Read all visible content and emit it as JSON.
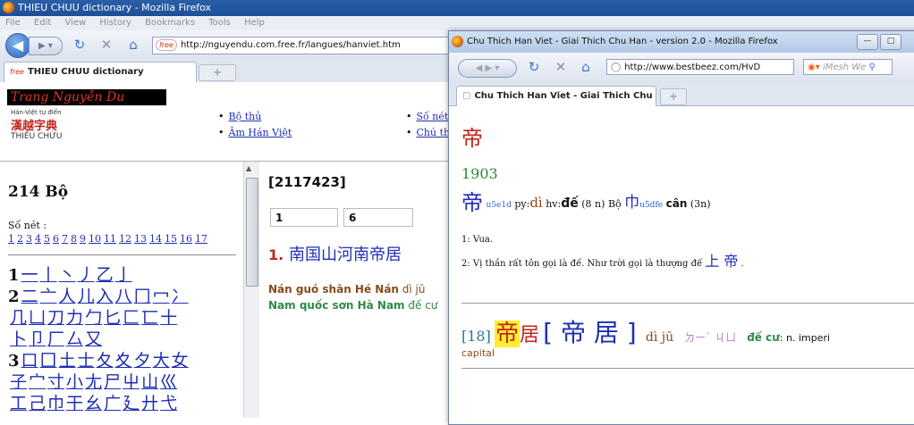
{
  "main_window": {
    "title": "THIEU CHUU dictionary - Mozilla Firefox",
    "menu": [
      "File",
      "Edit",
      "View",
      "History",
      "Bookmarks",
      "Tools",
      "Help"
    ],
    "url": "http://nguyendu.com.free.fr/langues/hanviet.htm",
    "url_favicon": "free",
    "tab_title": "THIEU CHUU dictionary",
    "logo": {
      "script": "Trang Nguyễn Du",
      "subtitle": "Hán-Việt tự điển",
      "han": "漢越字典",
      "latin": "THIỀU CHỬU"
    },
    "header_links": [
      {
        "label": "Bộ thủ"
      },
      {
        "label": "Âm Hán Việt"
      },
      {
        "label": "Số nét"
      },
      {
        "label": "Chú th"
      }
    ],
    "left_pane": {
      "title": "214 Bộ",
      "strokes_label": "Số nét :",
      "strokes": [
        "1",
        "2",
        "3",
        "4",
        "5",
        "6",
        "7",
        "8",
        "9",
        "10",
        "11",
        "12",
        "13",
        "14",
        "15",
        "16",
        "17"
      ],
      "radical_rows": [
        {
          "num": "1",
          "chars": [
            "一",
            "丨",
            "丶",
            "丿",
            "乙",
            "亅"
          ]
        },
        {
          "num": "2",
          "chars": [
            "二",
            "亠",
            "人",
            "儿",
            "入",
            "八",
            "冂",
            "冖",
            "冫"
          ]
        },
        {
          "num": "",
          "chars": [
            "几",
            "凵",
            "刀",
            "力",
            "勹",
            "匕",
            "匚",
            "匸",
            "十"
          ]
        },
        {
          "num": "",
          "chars": [
            "卜",
            "卩",
            "厂",
            "厶",
            "又"
          ]
        },
        {
          "num": "3",
          "chars": [
            "口",
            "囗",
            "土",
            "士",
            "夂",
            "夊",
            "夕",
            "大",
            "女"
          ]
        },
        {
          "num": "",
          "chars": [
            "子",
            "宀",
            "寸",
            "小",
            "尢",
            "尸",
            "屮",
            "山",
            "巛"
          ]
        },
        {
          "num": "",
          "chars": [
            "工",
            "己",
            "巾",
            "干",
            "幺",
            "广",
            "廴",
            "廾",
            "弋"
          ]
        }
      ]
    },
    "mid_pane": {
      "code": "[2117423]",
      "box1": "1",
      "box2": "6",
      "sentence_num": "1.",
      "sentence": "南国山河南帝居",
      "pinyin_bold": "Nán guó shān Hé Nán",
      "pinyin_rest": " dì jū",
      "viet_bold": "Nam quốc sơn Hà Nam",
      "viet_rest": " đế cư"
    }
  },
  "popup_window": {
    "title": "Chu Thich Han Viet - Giai Thich Chu Han - version 2.0 - Mozilla Firefox",
    "url": "http://www.bestbeez.com/HvD",
    "search_placeholder": "iMesh We",
    "tab_title": "Chu Thich Han Viet - Giai Thich Chu H...",
    "big_char": "帝",
    "entry_number": "1903",
    "char_line": {
      "char": "帝",
      "code": "u5e1d",
      "py_label": "py:",
      "py": "dì",
      "hv_label": "hv:",
      "hv": "đế",
      "strokes": "(8 n)",
      "bo_label": "Bộ",
      "radical": "巾",
      "radical_code": "u5dfe",
      "radical_name": "cân",
      "radical_strokes": "(3n)"
    },
    "definitions": [
      {
        "text": "1: Vua.",
        "han": "",
        "end": ""
      },
      {
        "text": "2: Vị thần rất tôn gọi là đế. Như trời gọi là thượng đế ",
        "han": "上 帝",
        "end": " ."
      }
    ],
    "compound": {
      "num": "[18]",
      "char1": "帝",
      "char2": "居",
      "bracket": "[ 帝 居 ]",
      "pinyin": "dì  jū",
      "zhuyin": "ㄉㄧˋ  ㄐㄩ",
      "viet": "đế cư",
      "en": ": n. imperi",
      "en2": "capital"
    }
  }
}
